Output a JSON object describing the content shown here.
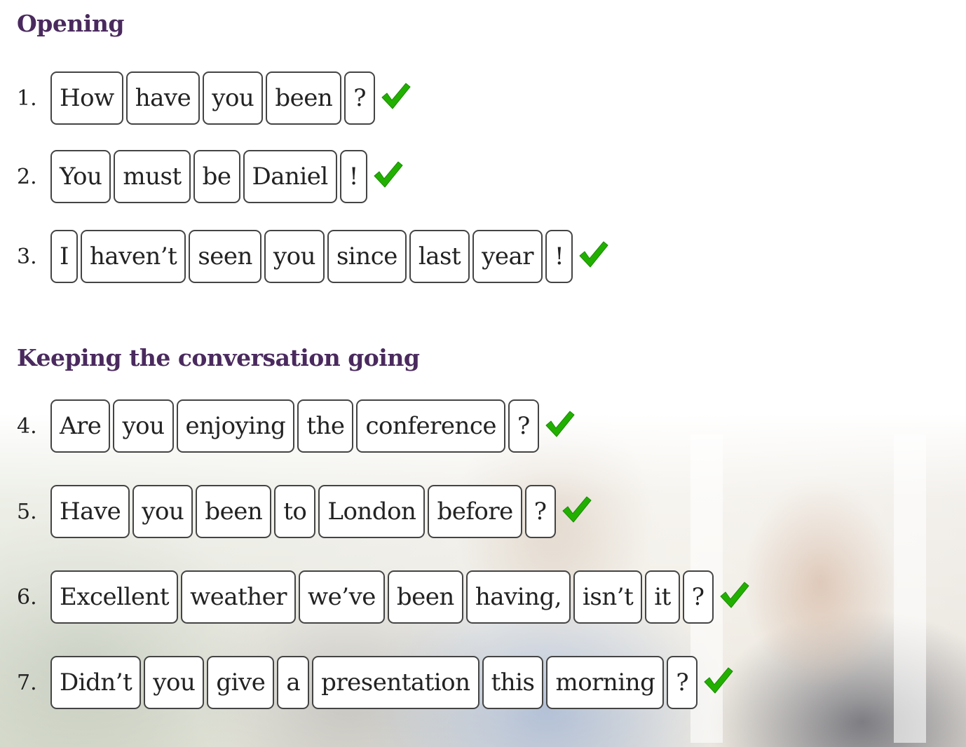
{
  "sections": [
    {
      "title": "Opening",
      "items": [
        {
          "number": "1.",
          "tokens": [
            "How",
            "have",
            "you",
            "been",
            "?"
          ],
          "status": "correct"
        },
        {
          "number": "2.",
          "tokens": [
            "You",
            "must",
            "be",
            "Daniel",
            "!"
          ],
          "status": "correct"
        },
        {
          "number": "3.",
          "tokens": [
            "I",
            "haven’t",
            "seen",
            "you",
            "since",
            "last",
            "year",
            "!"
          ],
          "status": "correct"
        }
      ]
    },
    {
      "title": "Keeping the conversation going",
      "items": [
        {
          "number": "4.",
          "tokens": [
            "Are",
            "you",
            "enjoying",
            "the",
            "conference",
            "?"
          ],
          "status": "correct"
        },
        {
          "number": "5.",
          "tokens": [
            "Have",
            "you",
            "been",
            "to",
            "London",
            "before",
            "?"
          ],
          "status": "correct"
        },
        {
          "number": "6.",
          "tokens": [
            "Excellent",
            "weather",
            "we’ve",
            "been",
            "having,",
            "isn’t",
            "it",
            "?"
          ],
          "status": "correct"
        },
        {
          "number": "7.",
          "tokens": [
            "Didn’t",
            "you",
            "give",
            "a",
            "presentation",
            "this",
            "morning",
            "?"
          ],
          "status": "correct"
        }
      ]
    }
  ],
  "icons": {
    "status": "check-icon"
  },
  "colors": {
    "heading": "#4a2a5e",
    "check": "#22b000",
    "token_border": "#444444"
  }
}
